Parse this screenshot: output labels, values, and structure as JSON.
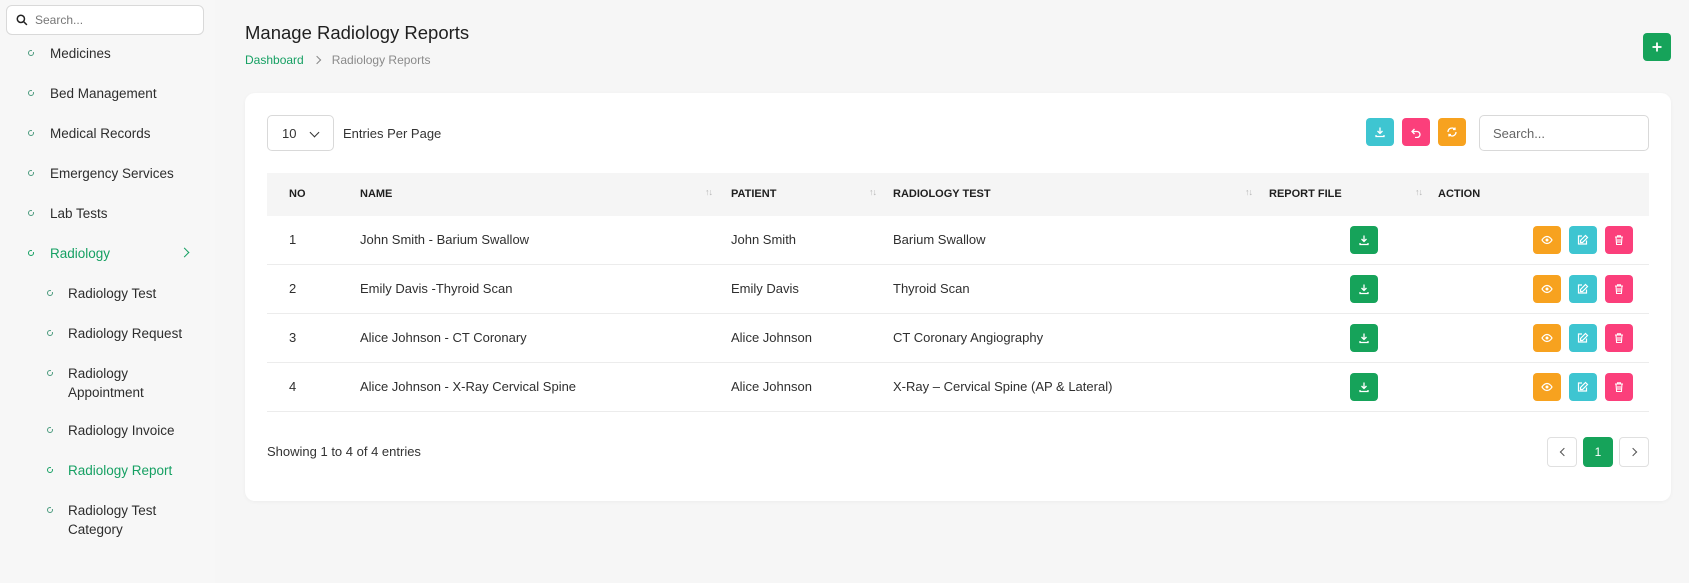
{
  "sidebar": {
    "search_placeholder": "Search...",
    "items": [
      {
        "label": "Medicines",
        "level": "top",
        "active": false
      },
      {
        "label": "Bed Management",
        "level": "top",
        "active": false
      },
      {
        "label": "Medical Records",
        "level": "top",
        "active": false
      },
      {
        "label": "Emergency Services",
        "level": "top",
        "active": false
      },
      {
        "label": "Lab Tests",
        "level": "top",
        "active": false
      },
      {
        "label": "Radiology",
        "level": "top",
        "active": true,
        "expanded": true
      },
      {
        "label": "Radiology Test",
        "level": "sub",
        "active": false
      },
      {
        "label": "Radiology Request",
        "level": "sub",
        "active": false
      },
      {
        "label": "Radiology Appointment",
        "level": "sub",
        "active": false
      },
      {
        "label": "Radiology Invoice",
        "level": "sub",
        "active": false
      },
      {
        "label": "Radiology Report",
        "level": "sub",
        "active": true
      },
      {
        "label": "Radiology Test Category",
        "level": "sub",
        "active": false
      }
    ]
  },
  "header": {
    "title": "Manage Radiology Reports",
    "breadcrumb": {
      "home": "Dashboard",
      "current": "Radiology Reports"
    },
    "add_icon": "plus-icon"
  },
  "table_controls": {
    "entries_value": "10",
    "entries_label": "Entries Per Page",
    "search_placeholder": "Search...",
    "tools": [
      "download-icon",
      "undo-icon",
      "refresh-icon"
    ]
  },
  "table": {
    "columns": [
      "NO",
      "NAME",
      "PATIENT",
      "RADIOLOGY TEST",
      "REPORT FILE",
      "ACTION"
    ],
    "rows": [
      {
        "no": "1",
        "name": "John Smith - Barium Swallow",
        "patient": "John Smith",
        "test": "Barium Swallow"
      },
      {
        "no": "2",
        "name": "Emily Davis -Thyroid Scan",
        "patient": "Emily Davis",
        "test": "Thyroid Scan"
      },
      {
        "no": "3",
        "name": "Alice Johnson - CT Coronary",
        "patient": "Alice Johnson",
        "test": "CT Coronary Angiography"
      },
      {
        "no": "4",
        "name": "Alice Johnson - X-Ray Cervical Spine",
        "patient": "Alice Johnson",
        "test": "X-Ray – Cervical Spine (AP & Lateral)"
      }
    ]
  },
  "footer": {
    "showing": "Showing 1 to 4 of 4 entries",
    "current_page": "1"
  },
  "colors": {
    "primary": "#16a35a",
    "info": "#3ec5d1",
    "danger": "#fb3f7b",
    "warning": "#f7a21f"
  }
}
